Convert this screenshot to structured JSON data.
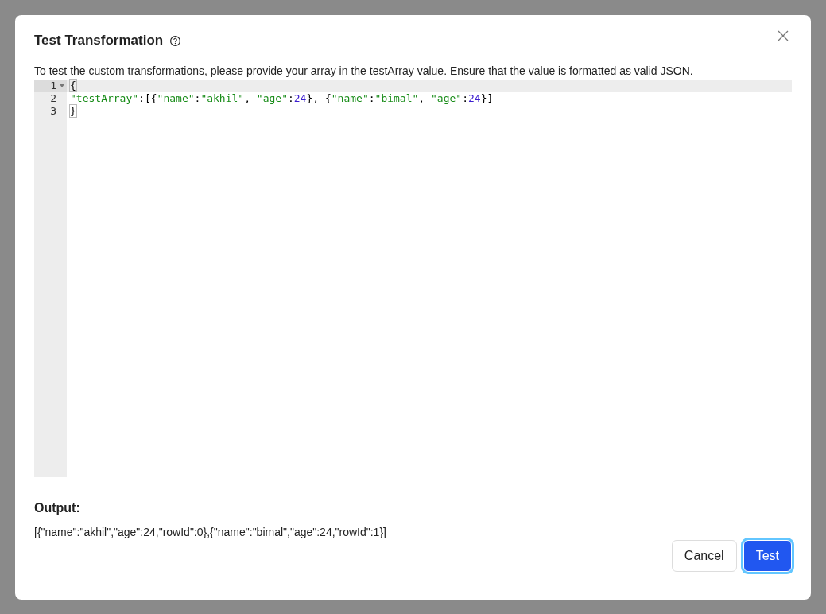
{
  "dialog": {
    "title": "Test Transformation",
    "description": "To test the custom transformations, please provide your array in the testArray value. Ensure that the value is formatted as valid JSON."
  },
  "editor": {
    "lines": [
      {
        "number": "1",
        "active": true,
        "foldable": true,
        "tokens": [
          {
            "kind": "bracket",
            "text": "{"
          }
        ]
      },
      {
        "number": "2",
        "active": false,
        "foldable": false,
        "tokens": [
          {
            "kind": "string",
            "text": "\"testArray\""
          },
          {
            "kind": "punct",
            "text": ":[{"
          },
          {
            "kind": "string",
            "text": "\"name\""
          },
          {
            "kind": "punct",
            "text": ":"
          },
          {
            "kind": "string",
            "text": "\"akhil\""
          },
          {
            "kind": "punct",
            "text": ", "
          },
          {
            "kind": "string",
            "text": "\"age\""
          },
          {
            "kind": "punct",
            "text": ":"
          },
          {
            "kind": "number",
            "text": "24"
          },
          {
            "kind": "punct",
            "text": "}, {"
          },
          {
            "kind": "string",
            "text": "\"name\""
          },
          {
            "kind": "punct",
            "text": ":"
          },
          {
            "kind": "string",
            "text": "\"bimal\""
          },
          {
            "kind": "punct",
            "text": ", "
          },
          {
            "kind": "string",
            "text": "\"age\""
          },
          {
            "kind": "punct",
            "text": ":"
          },
          {
            "kind": "number",
            "text": "24"
          },
          {
            "kind": "punct",
            "text": "}]"
          }
        ]
      },
      {
        "number": "3",
        "active": false,
        "foldable": false,
        "tokens": [
          {
            "kind": "bracket",
            "text": "}"
          }
        ]
      }
    ]
  },
  "output": {
    "label": "Output:",
    "value": "[{\"name\":\"akhil\",\"age\":24,\"rowId\":0},{\"name\":\"bimal\",\"age\":24,\"rowId\":1}]"
  },
  "buttons": [
    {
      "label": "Cancel",
      "kind": "secondary",
      "focused": false
    },
    {
      "label": "Test",
      "kind": "primary",
      "focused": true
    }
  ]
}
